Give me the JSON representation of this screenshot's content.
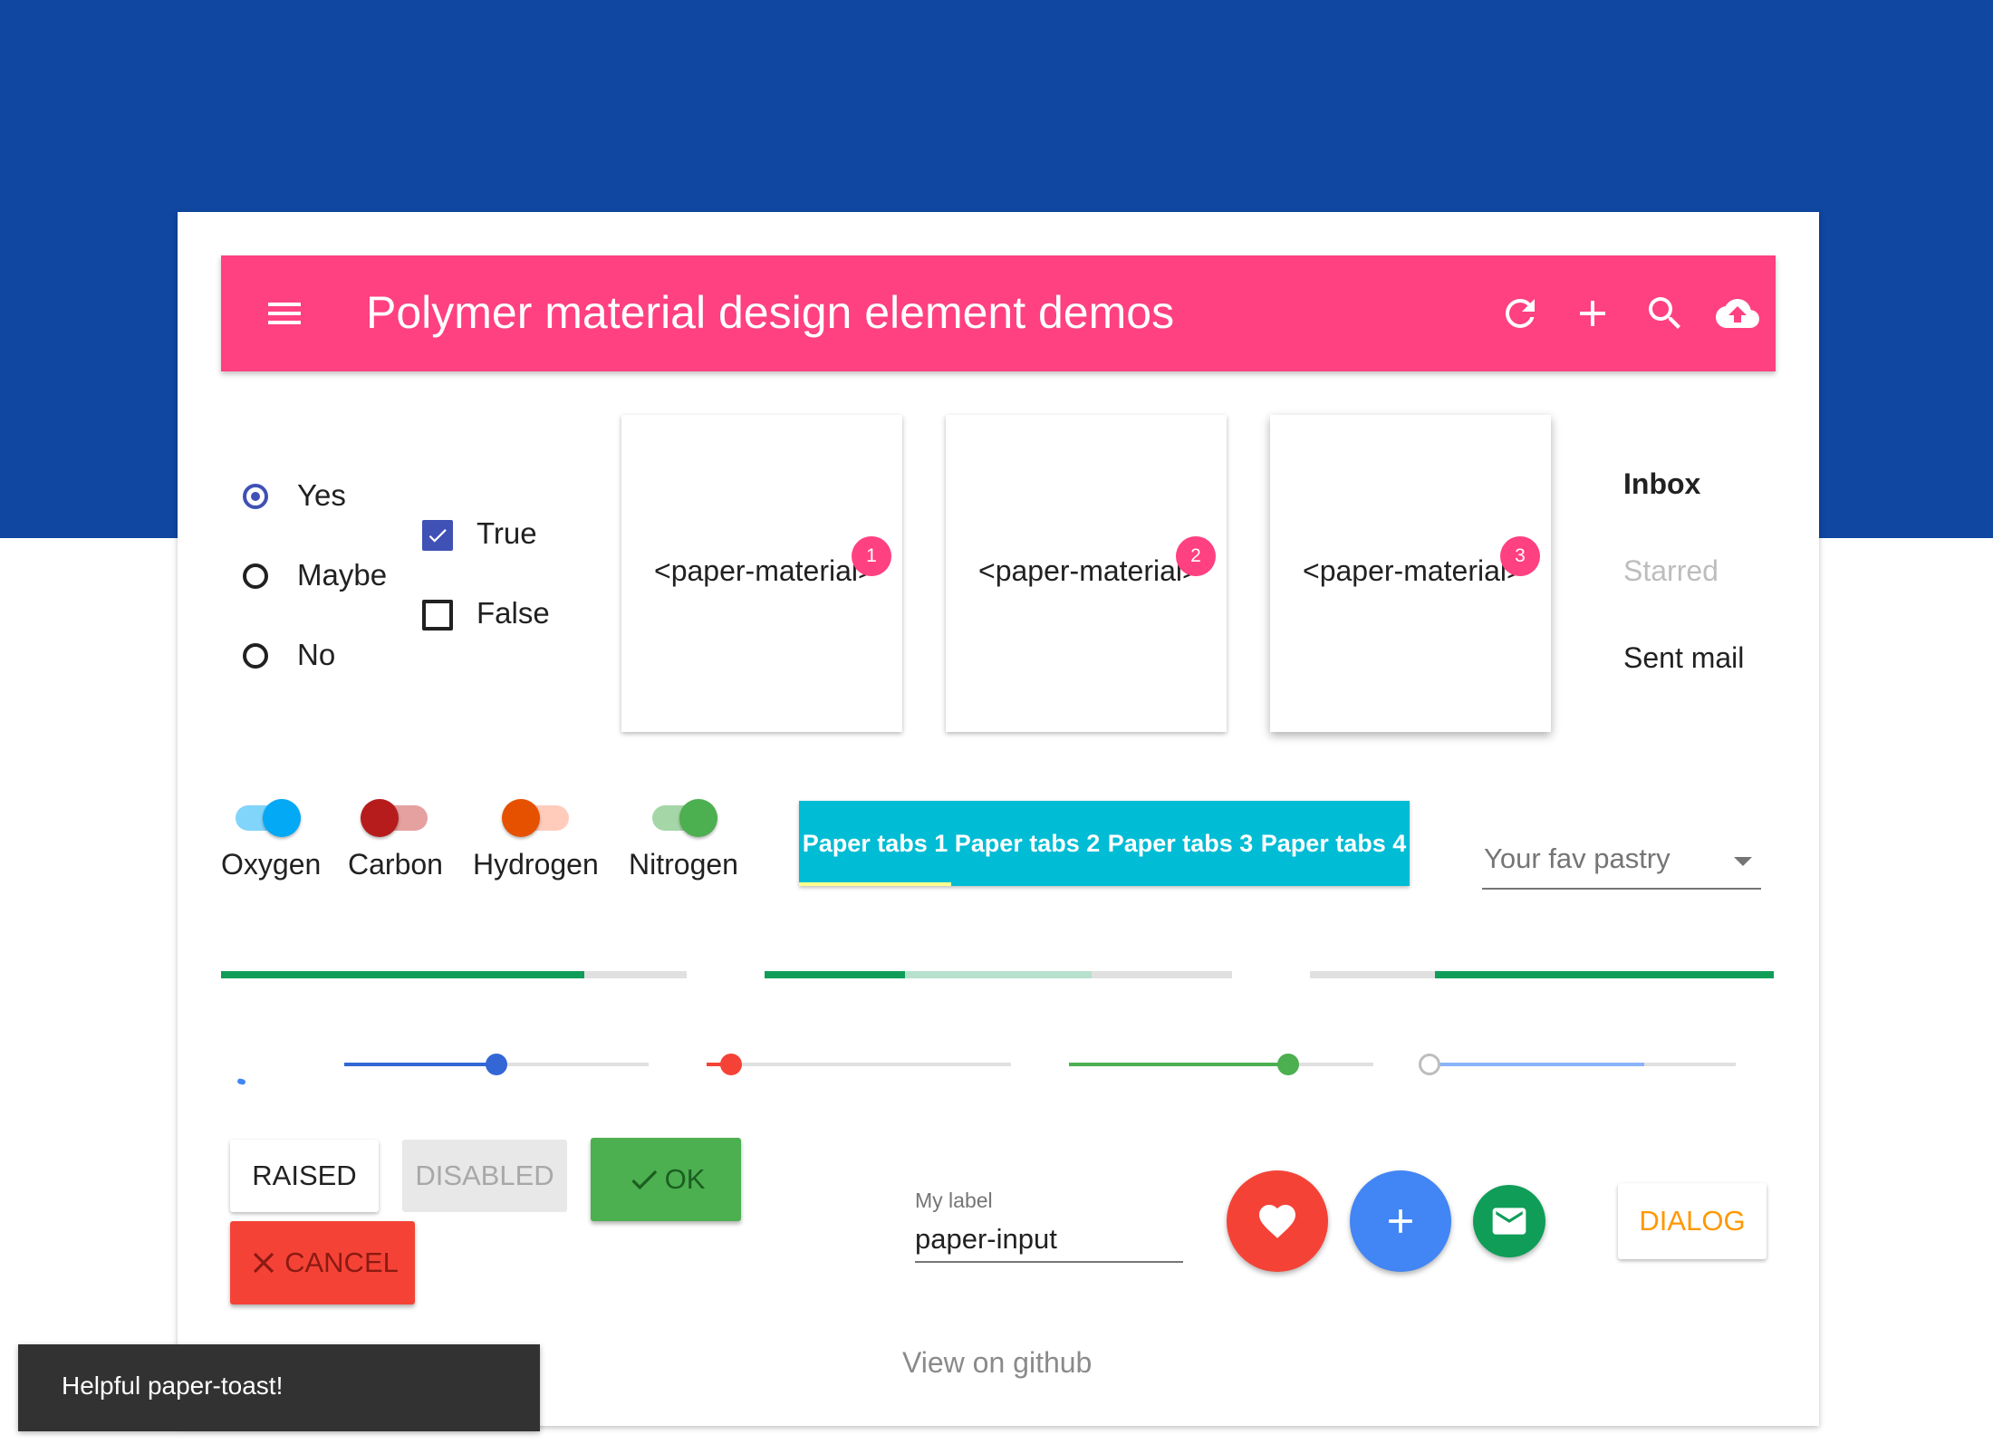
{
  "colors": {
    "hero": "#0f47a1",
    "toolbar": "#ff4081",
    "accent_indigo": "#3f51b5",
    "tabs": "#00bcd4",
    "progress": "#0f9d58",
    "cancel": "#f44336",
    "ok": "#4caf50",
    "dialog_text": "#ff9800"
  },
  "toolbar": {
    "title": "Polymer material design element demos",
    "menu_icon": "menu-icon",
    "actions": [
      "refresh-icon",
      "add-icon",
      "search-icon",
      "cloud-upload-icon"
    ]
  },
  "radios": [
    {
      "label": "Yes",
      "checked": true
    },
    {
      "label": "Maybe",
      "checked": false
    },
    {
      "label": "No",
      "checked": false
    }
  ],
  "checkboxes": [
    {
      "label": "True",
      "checked": true
    },
    {
      "label": "False",
      "checked": false
    }
  ],
  "paper_cards": [
    {
      "text": "<paper-material>",
      "badge": "1"
    },
    {
      "text": "<paper-material>",
      "badge": "2"
    },
    {
      "text": "<paper-material>",
      "badge": "3"
    }
  ],
  "menu": {
    "items": [
      {
        "label": "Inbox",
        "state": "selected"
      },
      {
        "label": "Starred",
        "state": "disabled"
      },
      {
        "label": "Sent mail",
        "state": "normal"
      }
    ]
  },
  "toggles": [
    {
      "label": "Oxygen",
      "on": true
    },
    {
      "label": "Carbon",
      "on": false
    },
    {
      "label": "Hydrogen",
      "on": false
    },
    {
      "label": "Nitrogen",
      "on": true
    }
  ],
  "tabs": {
    "items": [
      "Paper tabs 1",
      "Paper tabs 2",
      "Paper tabs 3",
      "Paper tabs 4"
    ],
    "selected": 0
  },
  "dropdown": {
    "placeholder": "Your fav pastry"
  },
  "progress": [
    {
      "value": 78,
      "secondary": 0
    },
    {
      "value": 30,
      "secondary": 70
    },
    {
      "value": 73,
      "secondary": 0
    }
  ],
  "sliders": [
    {
      "value": 50
    },
    {
      "value": 8
    },
    {
      "value": 72
    },
    {
      "value": 0,
      "secondary": 70
    }
  ],
  "buttons": {
    "raised": "RAISED",
    "disabled": "DISABLED",
    "ok": "OK",
    "cancel": "CANCEL",
    "dialog": "DIALOG"
  },
  "input": {
    "label": "My label",
    "value": "paper-input"
  },
  "fabs": [
    "favorite-icon",
    "add-icon",
    "mail-icon"
  ],
  "footer": {
    "link": "View on github"
  },
  "toast": {
    "text": "Helpful paper-toast!"
  }
}
